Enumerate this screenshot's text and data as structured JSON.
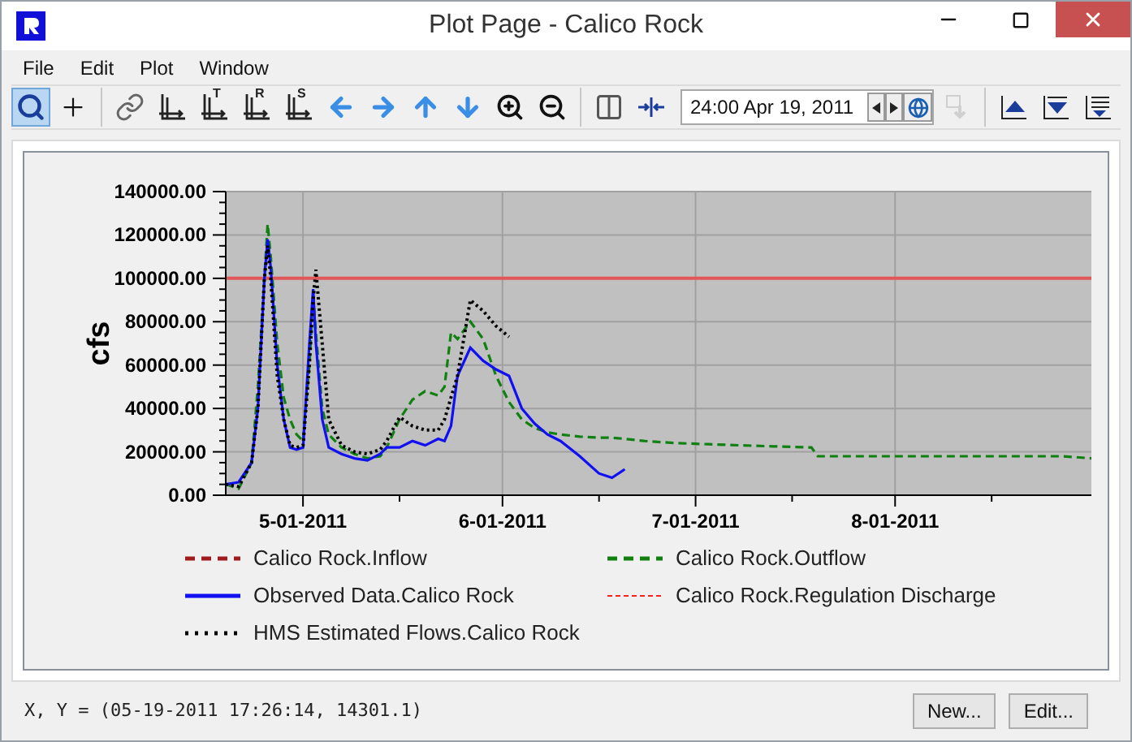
{
  "window": {
    "title": "Plot Page - Calico Rock"
  },
  "menu": [
    {
      "label": "File"
    },
    {
      "label": "Edit"
    },
    {
      "label": "Plot"
    },
    {
      "label": "Window"
    }
  ],
  "toolbar": [
    {
      "kind": "zoom",
      "selected": true
    },
    {
      "kind": "crosshair",
      "selected": false
    },
    {
      "kind": "sep"
    },
    {
      "kind": "link"
    },
    {
      "kind": "axes"
    },
    {
      "kind": "axes",
      "letter": "T"
    },
    {
      "kind": "axes",
      "letter": "R"
    },
    {
      "kind": "axes",
      "letter": "S"
    },
    {
      "kind": "left"
    },
    {
      "kind": "right"
    },
    {
      "kind": "up"
    },
    {
      "kind": "down"
    },
    {
      "kind": "zoom-in"
    },
    {
      "kind": "zoom-out"
    },
    {
      "kind": "sep"
    },
    {
      "kind": "split"
    },
    {
      "kind": "collapse"
    }
  ],
  "date_field": {
    "value": "24:00 Apr 19, 2011"
  },
  "toolbar_right": [
    {
      "kind": "disabled-tool",
      "disabled": true
    },
    {
      "kind": "sep"
    },
    {
      "kind": "top"
    },
    {
      "kind": "bottom"
    },
    {
      "kind": "list"
    }
  ],
  "plot": {
    "chart_data": {
      "type": "line",
      "ylabel": "cfs",
      "x": [
        "2011-04-19",
        "2011-04-21",
        "2011-04-23",
        "2011-04-24",
        "2011-04-25",
        "2011-04-25T12:00",
        "2011-04-26",
        "2011-04-27",
        "2011-04-28",
        "2011-04-29",
        "2011-04-30",
        "2011-05-01",
        "2011-05-02",
        "2011-05-02T14:00",
        "2011-05-03",
        "2011-05-04",
        "2011-05-05",
        "2011-05-07",
        "2011-05-09",
        "2011-05-11",
        "2011-05-13",
        "2011-05-14",
        "2011-05-16",
        "2011-05-18",
        "2011-05-20",
        "2011-05-22",
        "2011-05-23",
        "2011-05-24",
        "2011-05-25",
        "2011-05-27",
        "2011-05-29",
        "2011-05-31",
        "2011-06-02",
        "2011-06-04",
        "2011-06-06",
        "2011-06-08",
        "2011-06-10",
        "2011-06-13",
        "2011-06-16",
        "2011-06-18",
        "2011-06-20",
        "2011-06-23",
        "2011-06-28",
        "2011-07-03",
        "2011-07-08",
        "2011-07-13",
        "2011-07-19",
        "2011-07-20",
        "2011-07-28",
        "2011-08-07",
        "2011-08-17",
        "2011-08-27",
        "2011-08-31T12:00"
      ],
      "xlim": [
        "2011-04-19",
        "2011-08-31T12:00"
      ],
      "ylim": [
        0,
        140000
      ],
      "xticks": [
        {
          "value": "2011-05-01",
          "label": "5-01-2011"
        },
        {
          "value": "2011-06-01",
          "label": "6-01-2011"
        },
        {
          "value": "2011-07-01",
          "label": "7-01-2011"
        },
        {
          "value": "2011-08-01",
          "label": "8-01-2011"
        }
      ],
      "yticks": [
        {
          "value": 0,
          "label": "0.00"
        },
        {
          "value": 20000,
          "label": "20000.00"
        },
        {
          "value": 40000,
          "label": "40000.00"
        },
        {
          "value": 60000,
          "label": "60000.00"
        },
        {
          "value": 80000,
          "label": "80000.00"
        },
        {
          "value": 100000,
          "label": "100000.00"
        },
        {
          "value": 120000,
          "label": "120000.00"
        },
        {
          "value": 140000,
          "label": "140000.00"
        }
      ],
      "grid": true,
      "ref_lines": [
        {
          "axis": "y",
          "value": 100000,
          "color": "#e05858"
        }
      ],
      "series": [
        {
          "name": "Calico Rock.Inflow",
          "color": "#a01c1c",
          "line_style": "dashed",
          "values": [
            null,
            null,
            null,
            null,
            null,
            null,
            null,
            null,
            null,
            null,
            null,
            null,
            null,
            null,
            null,
            null,
            null,
            null,
            null,
            null,
            null,
            null,
            null,
            null,
            null,
            null,
            null,
            null,
            null,
            null,
            null,
            null,
            null,
            null,
            null,
            null,
            null,
            null,
            null,
            null,
            null,
            null,
            null,
            null,
            null,
            null,
            null,
            null,
            null,
            null,
            null,
            null,
            null
          ]
        },
        {
          "name": "Calico Rock.Outflow",
          "color": "#108010",
          "line_style": "dashed",
          "values": [
            5000,
            3000,
            15000,
            50000,
            100000,
            125000,
            110000,
            70000,
            45000,
            35000,
            28000,
            25000,
            60000,
            92000,
            75000,
            40000,
            28000,
            22000,
            19000,
            17000,
            18000,
            22000,
            35000,
            44000,
            48000,
            46000,
            50000,
            75000,
            72000,
            80000,
            72000,
            55000,
            43000,
            35000,
            31000,
            29000,
            28000,
            27000,
            26500,
            26500,
            26000,
            25000,
            24000,
            23500,
            23000,
            22500,
            22000,
            18000,
            18000,
            18000,
            18000,
            18000,
            17000
          ]
        },
        {
          "name": "Observed Data.Calico Rock",
          "color": "#1010f0",
          "line_style": "solid",
          "values": [
            5000,
            6000,
            15000,
            40000,
            100000,
            118000,
            105000,
            60000,
            35000,
            22000,
            21000,
            22000,
            70000,
            95000,
            70000,
            35000,
            22000,
            19000,
            17000,
            16000,
            19000,
            22000,
            22000,
            25000,
            23000,
            26000,
            25000,
            32000,
            55000,
            68000,
            62000,
            58000,
            55000,
            40000,
            33000,
            28000,
            25000,
            18000,
            10000,
            8000,
            12000,
            null,
            null,
            null,
            null,
            null,
            null,
            null,
            null,
            null,
            null,
            null,
            null
          ]
        },
        {
          "name": "Calico Rock.Regulation Discharge",
          "color": "#ff2020",
          "line_style": "dashed",
          "values": [
            null,
            null,
            null,
            null,
            null,
            null,
            null,
            null,
            null,
            null,
            null,
            null,
            null,
            null,
            null,
            null,
            null,
            null,
            null,
            null,
            null,
            null,
            null,
            null,
            null,
            null,
            null,
            null,
            null,
            null,
            null,
            null,
            null,
            null,
            null,
            null,
            null,
            null,
            null,
            null,
            null,
            null,
            null,
            null,
            null,
            null,
            null,
            null,
            null,
            null,
            null,
            null,
            null
          ]
        },
        {
          "name": "HMS Estimated Flows.Calico Rock",
          "color": "#000000",
          "line_style": "dotted",
          "values": [
            5000,
            4000,
            15000,
            40000,
            100000,
            115000,
            100000,
            55000,
            35000,
            23000,
            22000,
            23000,
            60000,
            90000,
            104000,
            70000,
            35000,
            23000,
            20000,
            19000,
            21000,
            25000,
            36000,
            32000,
            30000,
            30000,
            35000,
            45000,
            55000,
            90000,
            85000,
            78000,
            73000,
            null,
            null,
            null,
            null,
            null,
            null,
            null,
            null,
            null,
            null,
            null,
            null,
            null,
            null,
            null,
            null,
            null,
            null,
            null,
            null
          ]
        }
      ]
    }
  },
  "status_bar": {
    "text": "X, Y = (05-19-2011 17:26:14, 14301.1)"
  },
  "buttons": [
    {
      "label": "New..."
    },
    {
      "label": "Edit..."
    }
  ]
}
